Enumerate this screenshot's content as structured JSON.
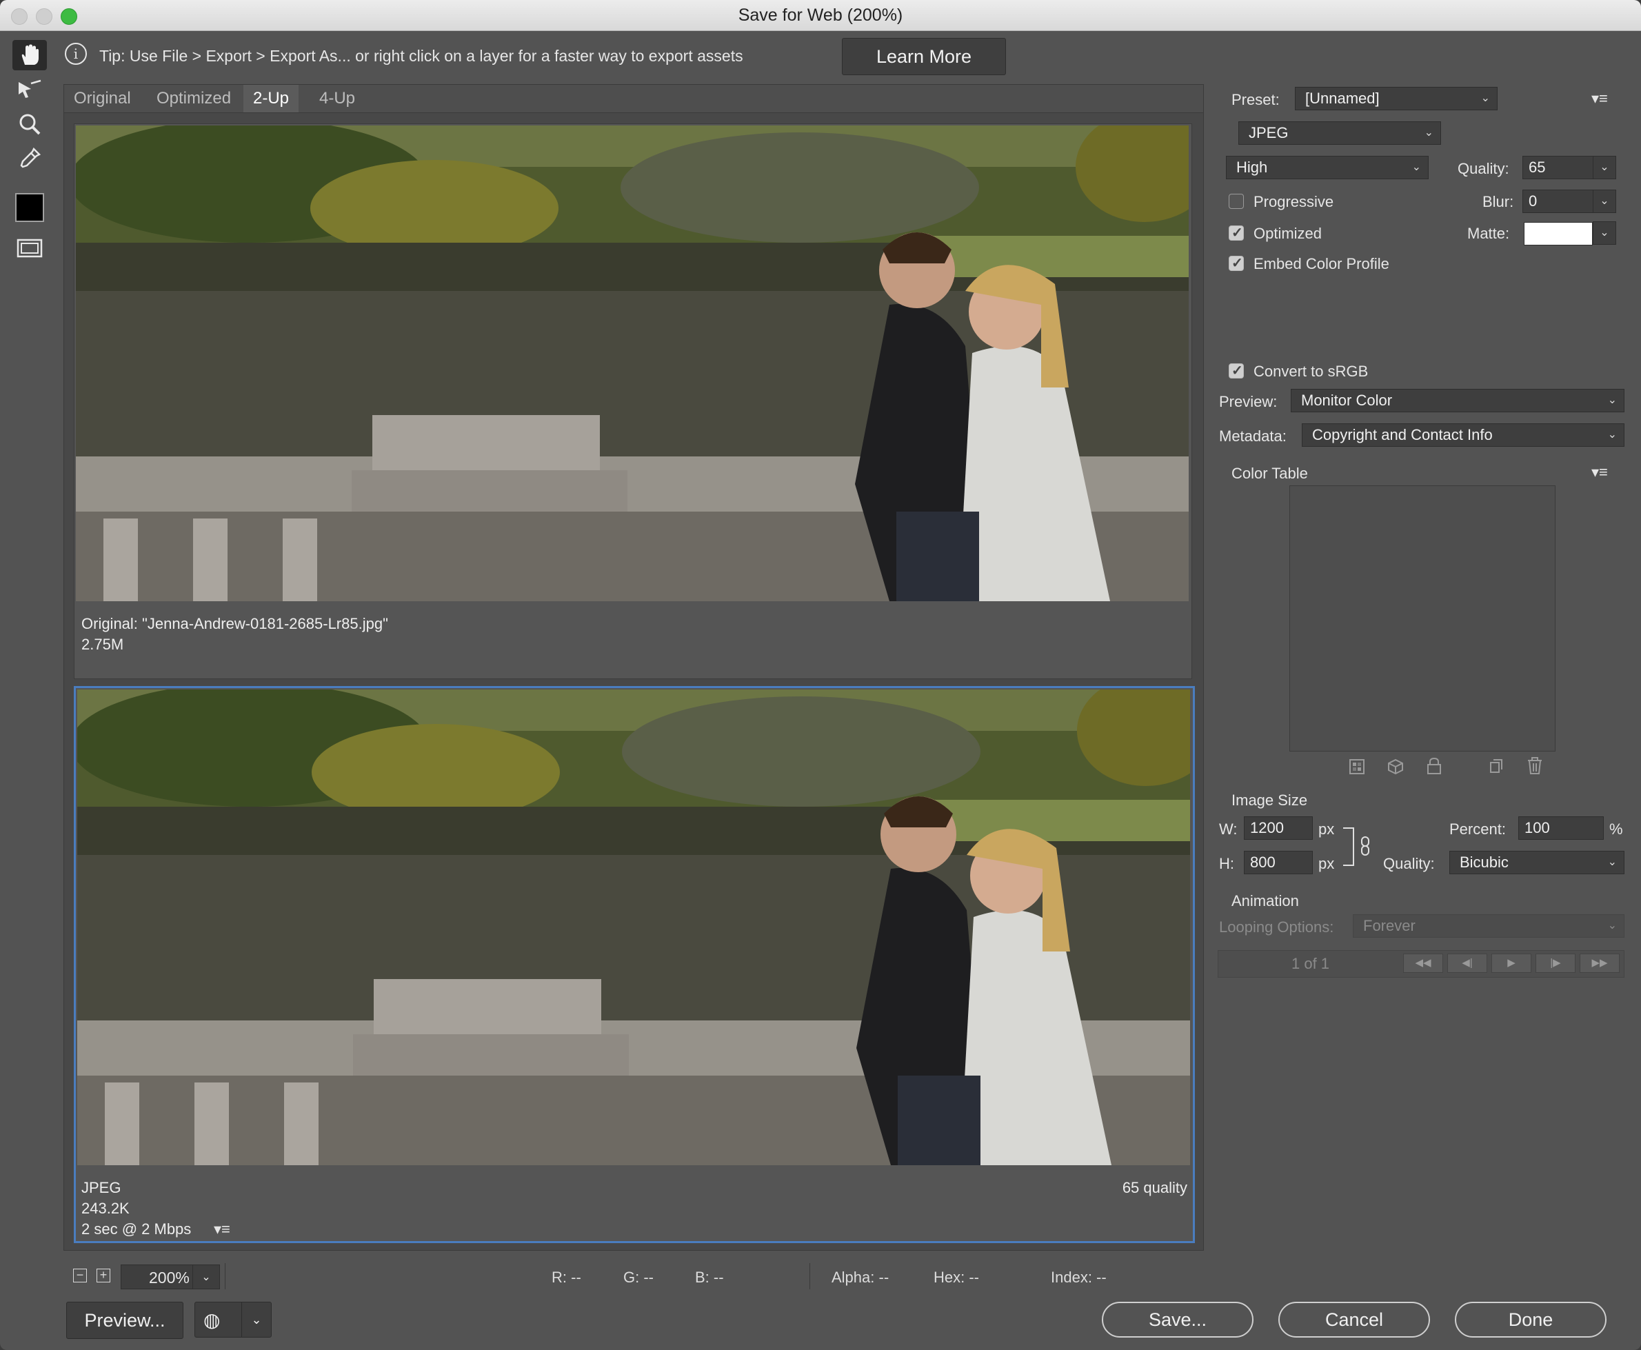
{
  "window": {
    "title": "Save for Web (200%)"
  },
  "tools": {
    "hand": "hand-tool-icon",
    "slice": "slice-select-tool-icon",
    "zoom": "zoom-tool-icon",
    "eyedropper": "eyedropper-tool-icon",
    "color_swatch": "#000000",
    "toggle_slices": "toggle-slices-icon"
  },
  "tip": {
    "text": "Tip: Use File > Export > Export As...  or right click on a layer for a faster way to export assets",
    "learn_more": "Learn More"
  },
  "view_tabs": [
    {
      "label": "Original",
      "active": false
    },
    {
      "label": "Optimized",
      "active": false
    },
    {
      "label": "2-Up",
      "active": true
    },
    {
      "label": "4-Up",
      "active": false
    }
  ],
  "original_pane": {
    "line1": "Original: \"Jenna-Andrew-0181-2685-Lr85.jpg\"",
    "line2": "2.75M"
  },
  "optimized_pane": {
    "format": "JPEG",
    "size": "243.2K",
    "download": "2 sec @ 2 Mbps",
    "quality": "65 quality"
  },
  "status": {
    "zoom": "200%",
    "r": "R: --",
    "g": "G: --",
    "b": "B: --",
    "alpha": "Alpha: --",
    "hex": "Hex: --",
    "index": "Index: --"
  },
  "buttons": {
    "preview": "Preview...",
    "save": "Save...",
    "cancel": "Cancel",
    "done": "Done"
  },
  "settings": {
    "preset_label": "Preset:",
    "preset_value": "[Unnamed]",
    "format": "JPEG",
    "compression": "High",
    "quality_label": "Quality:",
    "quality_value": "65",
    "blur_label": "Blur:",
    "blur_value": "0",
    "matte_label": "Matte:",
    "progressive": {
      "label": "Progressive",
      "checked": false
    },
    "optimized": {
      "label": "Optimized",
      "checked": true
    },
    "embed_profile": {
      "label": "Embed Color Profile",
      "checked": true
    },
    "convert_srgb": {
      "label": "Convert to sRGB",
      "checked": true
    },
    "preview_label": "Preview:",
    "preview_value": "Monitor Color",
    "metadata_label": "Metadata:",
    "metadata_value": "Copyright and Contact Info",
    "color_table_label": "Color Table"
  },
  "image_size": {
    "heading": "Image Size",
    "w_label": "W:",
    "w_value": "1200",
    "h_label": "H:",
    "h_value": "800",
    "unit": "px",
    "percent_label": "Percent:",
    "percent_value": "100",
    "percent_unit": "%",
    "quality_label": "Quality:",
    "quality_value": "Bicubic"
  },
  "animation": {
    "heading": "Animation",
    "looping_label": "Looping Options:",
    "looping_value": "Forever",
    "frame": "1 of 1"
  }
}
